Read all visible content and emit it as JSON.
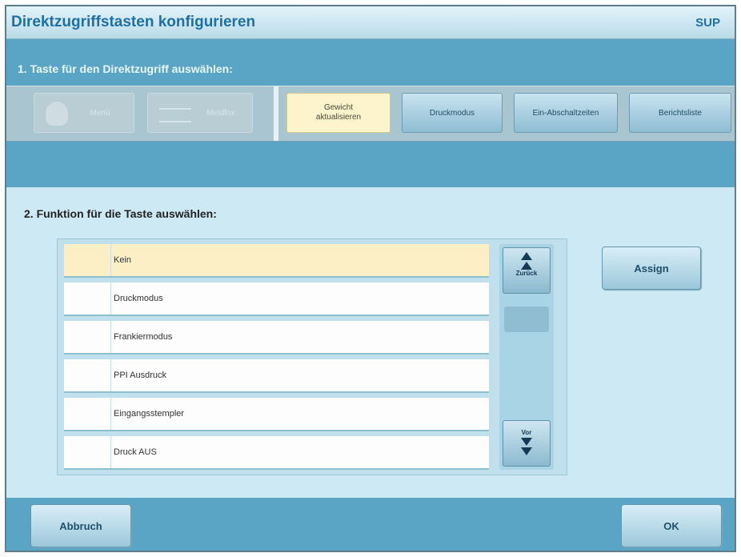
{
  "window": {
    "title": "Direktzugriffstasten konfigurieren",
    "user": "SUP"
  },
  "step1": {
    "heading": "1.  Taste für den Direktzugriff auswählen:",
    "keys": [
      {
        "label": "Menü",
        "state": "disabled"
      },
      {
        "label": "Meldfox",
        "state": "disabled"
      },
      {
        "label": "Gewicht aktualisieren",
        "state": "selected"
      },
      {
        "label": "Druckmodus",
        "state": "normal"
      },
      {
        "label": "Ein-Abschaltzeiten",
        "state": "normal"
      },
      {
        "label": "Berichtsliste",
        "state": "normal"
      }
    ]
  },
  "step2": {
    "heading": "2.  Funktion für die Taste auswählen:",
    "options": [
      "Kein",
      "Druckmodus",
      "Frankiermodus",
      "PPI Ausdruck",
      "Eingangsstempler",
      "Druck AUS"
    ],
    "selected_index": 0
  },
  "scroll": {
    "back_label": "Zurück",
    "next_label": "Vor"
  },
  "buttons": {
    "assign": "Assign",
    "cancel": "Abbruch",
    "ok": "OK"
  },
  "colors": {
    "title_text": "#1d6fa6",
    "band": "#5aa5c6",
    "selected": "#fcefc6",
    "background": "#cde9f3"
  }
}
